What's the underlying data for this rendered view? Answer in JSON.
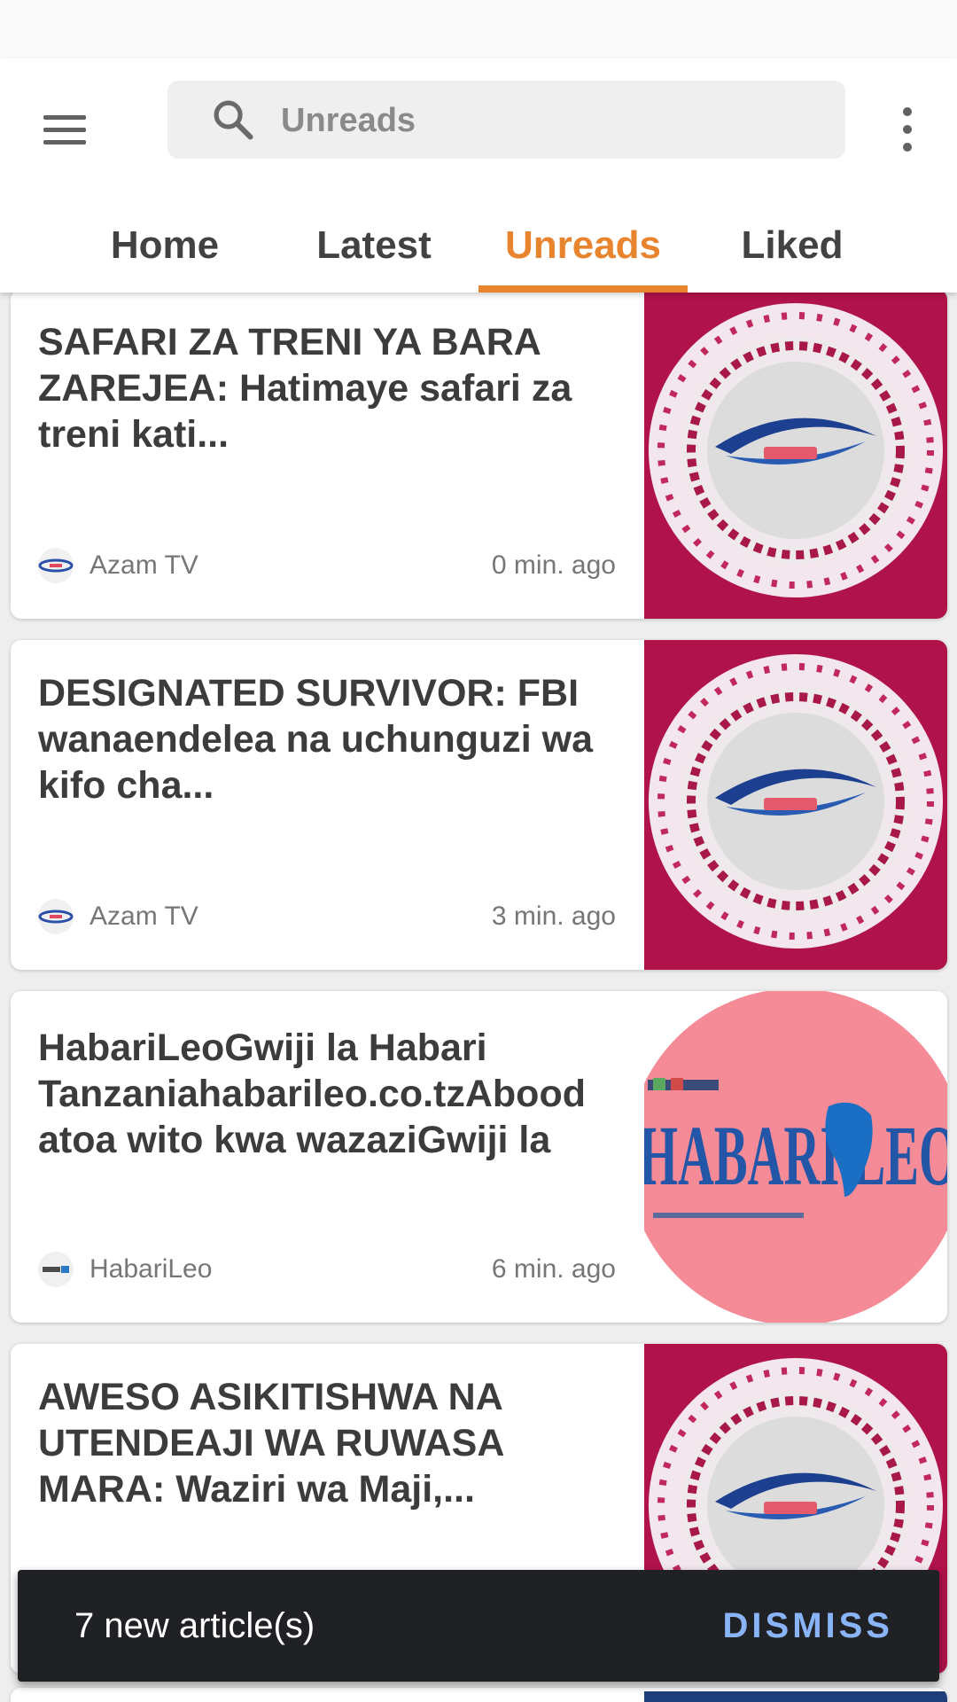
{
  "search": {
    "placeholder": "Unreads"
  },
  "tabs": [
    {
      "label": "Home",
      "active": false
    },
    {
      "label": "Latest",
      "active": false
    },
    {
      "label": "Unreads",
      "active": true
    },
    {
      "label": "Liked",
      "active": false
    }
  ],
  "articles": [
    {
      "title": "SAFARI ZA TRENI YA BARA ZAREJEA: Hatimaye safari za treni kati...",
      "source": "Azam TV",
      "time": "0 min. ago",
      "thumbnail": "azam-tv-logo"
    },
    {
      "title": "DESIGNATED SURVIVOR: FBI wanaendelea na uchunguzi wa kifo cha...",
      "source": "Azam TV",
      "time": "3 min. ago",
      "thumbnail": "azam-tv-logo"
    },
    {
      "title": "HabariLeoGwiji la Habari Tanzaniahabarileo.co.tzAbood atoa wito kwa wazaziGwiji la",
      "source": "HabariLeo",
      "time": "6 min. ago",
      "thumbnail": "habarileo-logo"
    },
    {
      "title": "AWESO ASIKITISHWA NA UTENDEAJI WA RUWASA MARA: Waziri wa Maji,...",
      "source": "",
      "time": "",
      "thumbnail": "azam-tv-logo"
    }
  ],
  "thumbnail_text": {
    "habarileo": "HABARI LEO"
  },
  "snackbar": {
    "message": "7 new article(s)",
    "action": "DISMISS"
  },
  "colors": {
    "accent": "#e8832e",
    "snackbar_bg": "#202124",
    "snackbar_action": "#8ab4f8",
    "azam_bg": "#b0124a",
    "habarileo_bg": "#f48b97"
  }
}
